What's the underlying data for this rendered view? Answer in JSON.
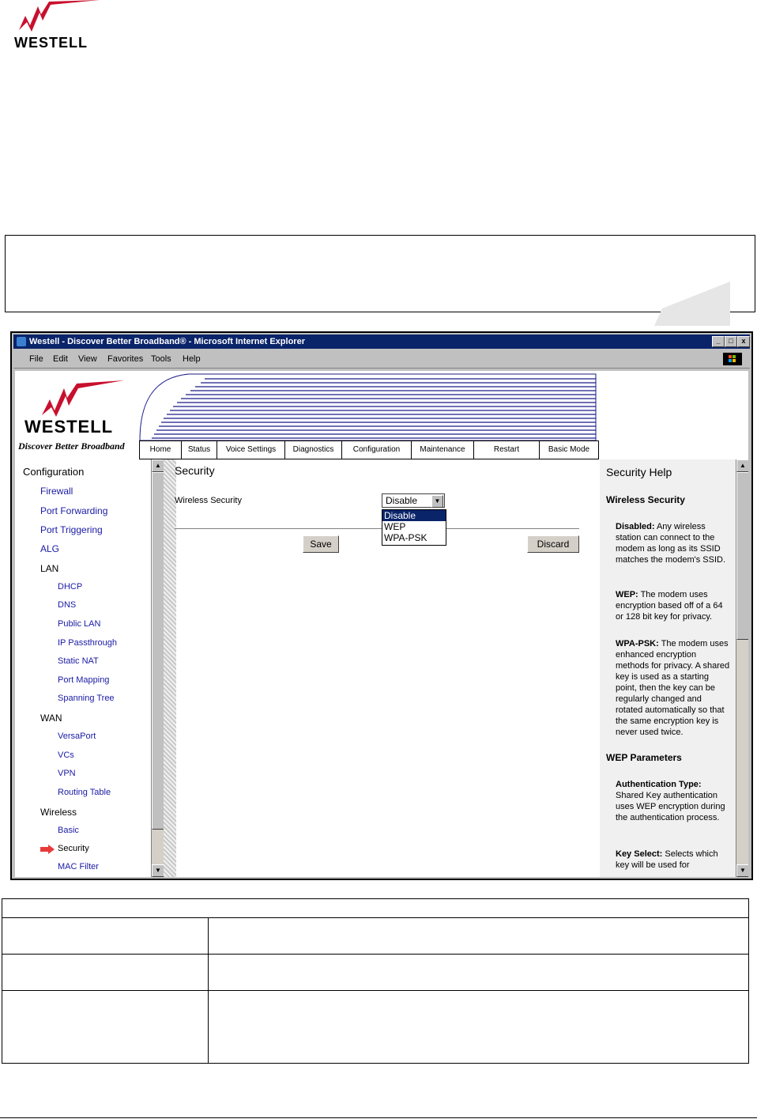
{
  "doc": {
    "logo_text": "WESTELL"
  },
  "window": {
    "title": "Westell - Discover Better Broadband® - Microsoft Internet Explorer",
    "minimize": "_",
    "maximize": "□",
    "close": "x"
  },
  "menubar": [
    "File",
    "Edit",
    "View",
    "Favorites",
    "Tools",
    "Help"
  ],
  "banner": {
    "logo": "WESTELL",
    "tagline": "Discover Better Broadband",
    "tabs": [
      "Home",
      "Status",
      "Voice Settings",
      "Diagnostics",
      "Configuration",
      "Maintenance",
      "Restart",
      "Basic Mode"
    ]
  },
  "left_nav": {
    "heading": "Configuration",
    "items": [
      {
        "label": "Firewall",
        "level": 1
      },
      {
        "label": "Port Forwarding",
        "level": 1
      },
      {
        "label": "Port Triggering",
        "level": 1
      },
      {
        "label": "ALG",
        "level": 1
      },
      {
        "label": "LAN",
        "level": 0
      },
      {
        "label": "DHCP",
        "level": 2
      },
      {
        "label": "DNS",
        "level": 2
      },
      {
        "label": "Public LAN",
        "level": 2
      },
      {
        "label": "IP Passthrough",
        "level": 2
      },
      {
        "label": "Static NAT",
        "level": 2
      },
      {
        "label": "Port Mapping",
        "level": 2
      },
      {
        "label": "Spanning Tree",
        "level": 2
      },
      {
        "label": "WAN",
        "level": 0
      },
      {
        "label": "VersaPort",
        "level": 2
      },
      {
        "label": "VCs",
        "level": 2
      },
      {
        "label": "VPN",
        "level": 2
      },
      {
        "label": "Routing Table",
        "level": 2
      },
      {
        "label": "Wireless",
        "level": 0
      },
      {
        "label": "Basic",
        "level": 2
      },
      {
        "label": "Security",
        "level": 2,
        "current": true
      },
      {
        "label": "MAC Filter",
        "level": 2
      }
    ]
  },
  "main": {
    "title": "Security",
    "field_label": "Wireless Security",
    "select_value": "Disable",
    "options": [
      "Disable",
      "WEP",
      "WPA-PSK"
    ],
    "save": "Save",
    "discard": "Discard"
  },
  "help": {
    "title": "Security Help",
    "section1": "Wireless Security",
    "items": [
      {
        "term": "Disabled:",
        "text": " Any wireless station can connect to the modem as long as its SSID matches the modem's SSID."
      },
      {
        "term": "WEP:",
        "text": " The modem uses encryption based off of a 64 or 128 bit key for privacy."
      },
      {
        "term": "WPA-PSK:",
        "text": " The modem uses enhanced encryption methods for privacy. A shared key is used as a starting point, then the key can be regularly changed and rotated automatically so that the same encryption key is never used twice."
      }
    ],
    "section2": "WEP Parameters",
    "items2": [
      {
        "term": "Authentication Type:",
        "text": " Shared Key authentication uses WEP encryption during the authentication process."
      },
      {
        "term": "Key Select:",
        "text": " Selects which key will be used for"
      }
    ]
  }
}
